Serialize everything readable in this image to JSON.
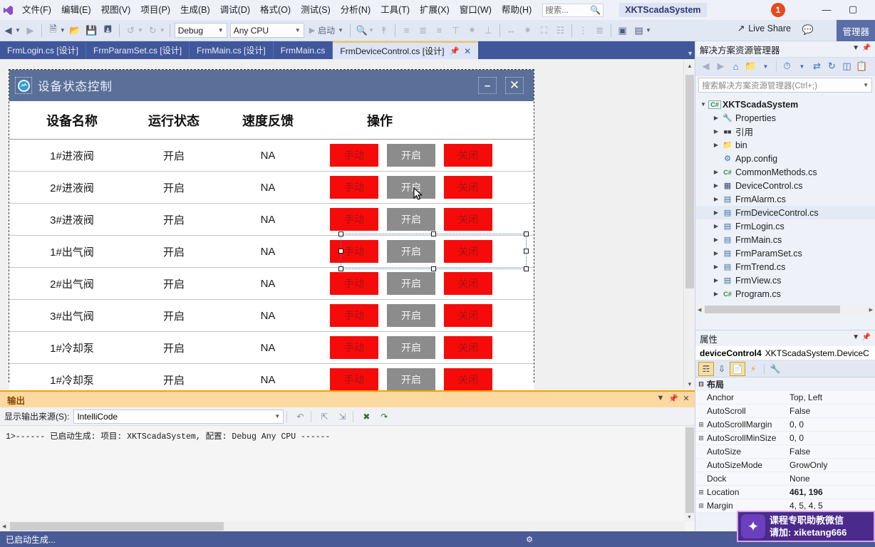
{
  "menu": {
    "items": [
      "文件(F)",
      "编辑(E)",
      "视图(V)",
      "项目(P)",
      "生成(B)",
      "调试(D)",
      "格式(O)",
      "测试(S)",
      "分析(N)",
      "工具(T)",
      "扩展(X)",
      "窗口(W)",
      "帮助(H)"
    ],
    "search_placeholder": "搜索...",
    "solution_name": "XKTScadaSystem",
    "notification_count": "1",
    "window_min": "—",
    "window_max": "▢"
  },
  "toolbar": {
    "config": "Debug",
    "platform": "Any CPU",
    "run_label": "启动",
    "live_share": "Live Share",
    "manage_label": "管理器"
  },
  "tabs": [
    {
      "label": "FrmLogin.cs [设计]",
      "active": false
    },
    {
      "label": "FrmParamSet.cs [设计]",
      "active": false
    },
    {
      "label": "FrmMain.cs [设计]",
      "active": false
    },
    {
      "label": "FrmMain.cs",
      "active": false
    },
    {
      "label": "FrmDeviceControl.cs [设计]",
      "active": true
    }
  ],
  "designer_form": {
    "title": "设备状态控制",
    "minimize_label": "–",
    "close_label": "✕",
    "columns": [
      "设备名称",
      "运行状态",
      "速度反馈",
      "操作"
    ],
    "rows": [
      {
        "name": "1#进液阀",
        "status": "开启",
        "speed": "NA",
        "selected": false
      },
      {
        "name": "2#进液阀",
        "status": "开启",
        "speed": "NA",
        "selected": false
      },
      {
        "name": "3#进液阀",
        "status": "开启",
        "speed": "NA",
        "selected": false
      },
      {
        "name": "1#出气阀",
        "status": "开启",
        "speed": "NA",
        "selected": true
      },
      {
        "name": "2#出气阀",
        "status": "开启",
        "speed": "NA",
        "selected": false
      },
      {
        "name": "3#出气阀",
        "status": "开启",
        "speed": "NA",
        "selected": false
      },
      {
        "name": "1#冷却泵",
        "status": "开启",
        "speed": "NA",
        "selected": false
      },
      {
        "name": "1#冷却泵",
        "status": "开启",
        "speed": "NA",
        "selected": false
      }
    ],
    "buttons": {
      "manual": "手动",
      "start": "开启",
      "stop": "关闭"
    },
    "colors": {
      "manual_bg": "#f60b0b",
      "start_bg": "#8c8c8c",
      "stop_bg": "#f60b0b",
      "titlebar": "#5b7098"
    }
  },
  "output": {
    "title": "输出",
    "source_label": "显示输出来源(S):",
    "source_value": "IntelliCode",
    "lines": [
      "1>------ 已启动生成: 项目: XKTScadaSystem, 配置: Debug Any CPU ------"
    ]
  },
  "solution_explorer": {
    "title": "解决方案资源管理器",
    "search_placeholder": "搜索解决方案资源管理器(Ctrl+;)",
    "tree": [
      {
        "label": "XKTScadaSystem",
        "icon": "C#",
        "depth": 0,
        "expanded": true,
        "root": true,
        "selected": false
      },
      {
        "label": "Properties",
        "icon": "🔧",
        "depth": 1,
        "expanded": false,
        "root": false,
        "selected": false
      },
      {
        "label": "引用",
        "icon": "▪▪",
        "depth": 1,
        "expanded": false,
        "root": false,
        "selected": false
      },
      {
        "label": "bin",
        "icon": "📁",
        "depth": 1,
        "expanded": false,
        "root": false,
        "selected": false
      },
      {
        "label": "App.config",
        "icon": "⚙",
        "depth": 1,
        "expanded": null,
        "root": false,
        "selected": false
      },
      {
        "label": "CommonMethods.cs",
        "icon": "C#",
        "depth": 1,
        "expanded": false,
        "root": false,
        "selected": false
      },
      {
        "label": "DeviceControl.cs",
        "icon": "▣",
        "depth": 1,
        "expanded": false,
        "root": false,
        "selected": false
      },
      {
        "label": "FrmAlarm.cs",
        "icon": "▤",
        "depth": 1,
        "expanded": false,
        "root": false,
        "selected": false
      },
      {
        "label": "FrmDeviceControl.cs",
        "icon": "▤",
        "depth": 1,
        "expanded": false,
        "root": false,
        "selected": true
      },
      {
        "label": "FrmLogin.cs",
        "icon": "▤",
        "depth": 1,
        "expanded": false,
        "root": false,
        "selected": false
      },
      {
        "label": "FrmMain.cs",
        "icon": "▤",
        "depth": 1,
        "expanded": false,
        "root": false,
        "selected": false
      },
      {
        "label": "FrmParamSet.cs",
        "icon": "▤",
        "depth": 1,
        "expanded": false,
        "root": false,
        "selected": false
      },
      {
        "label": "FrmTrend.cs",
        "icon": "▤",
        "depth": 1,
        "expanded": false,
        "root": false,
        "selected": false
      },
      {
        "label": "FrmView.cs",
        "icon": "▤",
        "depth": 1,
        "expanded": false,
        "root": false,
        "selected": false
      },
      {
        "label": "Program.cs",
        "icon": "C#",
        "depth": 1,
        "expanded": false,
        "root": false,
        "selected": false
      }
    ]
  },
  "properties": {
    "title": "属性",
    "object_name": "deviceControl4",
    "object_type": "XKTScadaSystem.DeviceC",
    "category": "布局",
    "rows": [
      {
        "name": "Anchor",
        "value": "Top, Left",
        "expandable": false,
        "bold": false
      },
      {
        "name": "AutoScroll",
        "value": "False",
        "expandable": false,
        "bold": false
      },
      {
        "name": "AutoScrollMargin",
        "value": "0, 0",
        "expandable": true,
        "bold": false
      },
      {
        "name": "AutoScrollMinSize",
        "value": "0, 0",
        "expandable": true,
        "bold": false
      },
      {
        "name": "AutoSize",
        "value": "False",
        "expandable": false,
        "bold": false
      },
      {
        "name": "AutoSizeMode",
        "value": "GrowOnly",
        "expandable": false,
        "bold": false
      },
      {
        "name": "Dock",
        "value": "None",
        "expandable": false,
        "bold": false
      },
      {
        "name": "Location",
        "value": "461, 196",
        "expandable": true,
        "bold": true
      },
      {
        "name": "Margin",
        "value": "4, 5, 4, 5",
        "expandable": true,
        "bold": false
      }
    ]
  },
  "statusbar": {
    "text": "已启动生成..."
  },
  "watermark": {
    "line1": "课程专职助教微信",
    "line2": "请加: xiketang666"
  }
}
